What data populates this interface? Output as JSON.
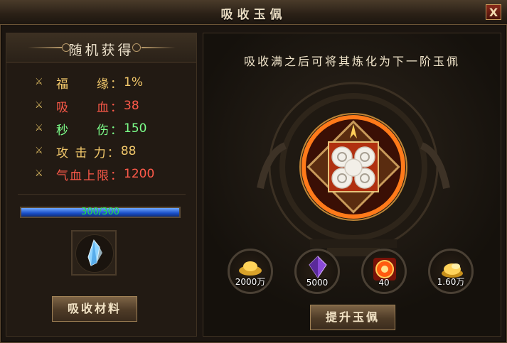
{
  "window": {
    "title": "吸收玉佩",
    "close_label": "X"
  },
  "left": {
    "header": "随机获得",
    "stats": [
      {
        "label": "福　　缘：",
        "value": "1%",
        "color": "#f2c86b"
      },
      {
        "label": "吸　　血：",
        "value": "38",
        "color": "#ff5a4a"
      },
      {
        "label": "秒　　伤：",
        "value": "150",
        "color": "#7cff8a"
      },
      {
        "label": "攻 击 力：",
        "value": "88",
        "color": "#f2c86b"
      },
      {
        "label": "气血上限：",
        "value": "1200",
        "color": "#ff5a4a"
      }
    ],
    "progress": {
      "text": "300/300",
      "fraction": 1.0
    },
    "material_icon": "blue-crystal-icon",
    "absorb_button": "吸收材料"
  },
  "right": {
    "hint": "吸收满之后可将其炼化为下一阶玉佩",
    "jade_icon": "jade-pendant-icon",
    "resources": [
      {
        "icon": "gold-ingot-icon",
        "count": "2000万"
      },
      {
        "icon": "purple-gem-icon",
        "count": "5000"
      },
      {
        "icon": "fire-orb-icon",
        "count": "40"
      },
      {
        "icon": "gold-coins-icon",
        "count": "1.60万"
      }
    ],
    "upgrade_button": "提升玉佩"
  }
}
